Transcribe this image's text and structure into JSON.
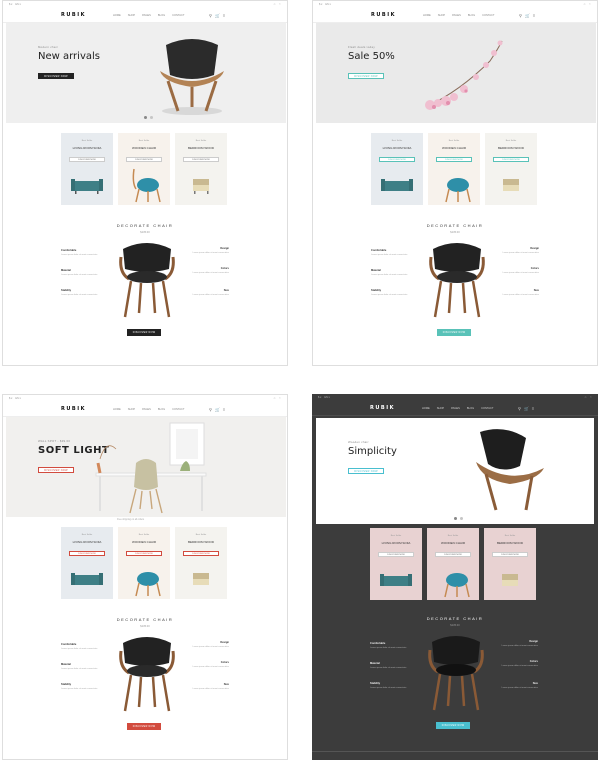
{
  "colors": {
    "dark_bg": "#3c3c3c",
    "teal": "#59c2b8",
    "red": "#d24b3e",
    "cyan": "#49bfcf",
    "black": "#222222"
  },
  "pages": [
    {
      "logo": "RUBIK",
      "hero": {
        "subtitle": "Modern chair",
        "title": "New arrivals",
        "button": "DISCOVER NOW"
      },
      "cards": [
        {
          "caption": "Best Seller",
          "name": "LIVING ROOM SOFA",
          "button": "DISCOVER NOW"
        },
        {
          "caption": "Best Seller",
          "name": "WOODEN CHAIR",
          "button": "DISCOVER NOW"
        },
        {
          "caption": "Best Seller",
          "name": "BEDROOM WOOD",
          "button": "DISCOVER NOW"
        }
      ],
      "feature": {
        "title": "DECORATE CHAIR",
        "price": "$135.00",
        "button": "DISCOVER NOW"
      }
    },
    {
      "logo": "RUBIK",
      "hero": {
        "subtitle": "Flash deals today",
        "title": "Sale 50%",
        "button": "DISCOVER NOW"
      },
      "cards": [
        {
          "caption": "Best Seller",
          "name": "LIVING ROOM SOFA",
          "button": "DISCOVER NOW"
        },
        {
          "caption": "Best Seller",
          "name": "WOODEN CHAIR",
          "button": "DISCOVER NOW"
        },
        {
          "caption": "Best Seller",
          "name": "BEDROOM WOOD",
          "button": "DISCOVER NOW"
        }
      ],
      "feature": {
        "title": "DECORATE CHAIR",
        "price": "$135.00",
        "button": "DISCOVER NOW"
      }
    },
    {
      "logo": "RUBIK",
      "hero": {
        "subtitle": "WALL SPOT - $39.00",
        "title": "SOFT LIGHT",
        "button": "DISCOVER NOW"
      },
      "cards": [
        {
          "caption": "Best Seller",
          "name": "LIVING ROOM SOFA",
          "button": "DISCOVER NOW"
        },
        {
          "caption": "Best Seller",
          "name": "WOODEN CHAIR",
          "button": "DISCOVER NOW"
        },
        {
          "caption": "Best Seller",
          "name": "BEDROOM WOOD",
          "button": "DISCOVER NOW"
        }
      ],
      "feature": {
        "title": "DECORATE CHAIR",
        "price": "$135.00",
        "button": "DISCOVER NOW"
      }
    },
    {
      "logo": "RUBIK",
      "hero": {
        "subtitle": "Wooden chair",
        "title": "Simplicity",
        "button": "DISCOVER NOW"
      },
      "cards": [
        {
          "caption": "Best Seller",
          "name": "LIVING ROOM SOFA",
          "button": "DISCOVER NOW"
        },
        {
          "caption": "Best Seller",
          "name": "WOODEN CHAIR",
          "button": "DISCOVER NOW"
        },
        {
          "caption": "Best Seller",
          "name": "BEDROOM WOOD",
          "button": "DISCOVER NOW"
        }
      ],
      "feature": {
        "title": "DECORATE CHAIR",
        "price": "$135.00",
        "button": "DISCOVER NOW"
      }
    }
  ],
  "nav": [
    "HOME",
    "SHOP",
    "PAGES",
    "BLOG",
    "CONTACT"
  ]
}
